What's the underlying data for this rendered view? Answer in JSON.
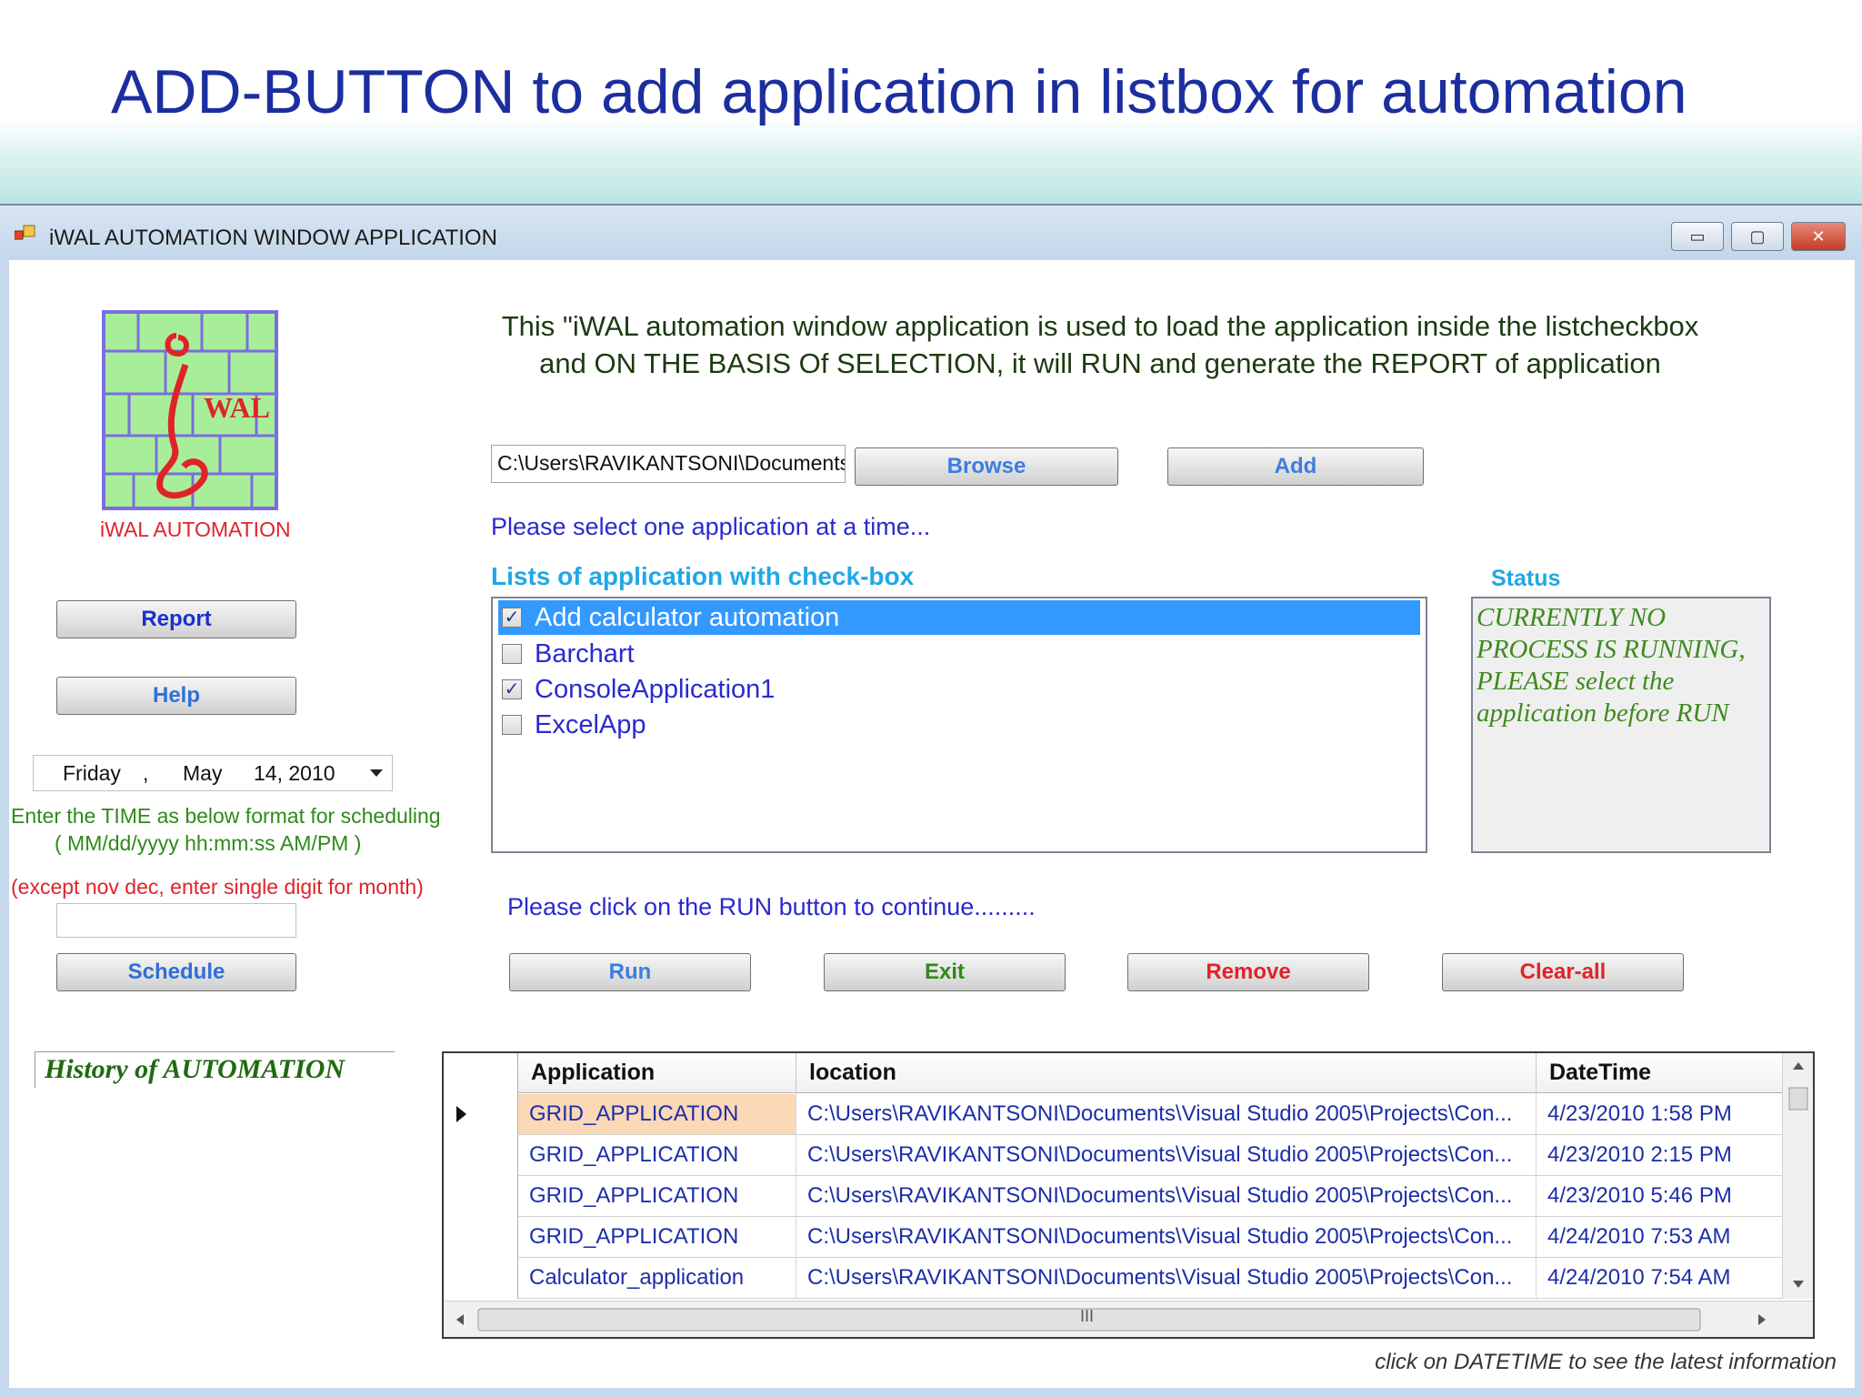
{
  "slide": {
    "title": "ADD-BUTTON  to add application in listbox for automation"
  },
  "window": {
    "title": "iWAL AUTOMATION WINDOW APPLICATION",
    "controls": {
      "minimize": "▭",
      "maximize": "▢",
      "close": "✕"
    }
  },
  "logo": {
    "text": "WAL",
    "caption": "iWAL AUTOMATION"
  },
  "description": {
    "line1": "This \"iWAL automation window application is used to load the application inside the listcheckbox",
    "line2": "and ON THE BASIS Of SELECTION, it will RUN and generate the REPORT of application"
  },
  "path_input": {
    "value": "C:\\Users\\RAVIKANTSONI\\Documents"
  },
  "buttons": {
    "browse": "Browse",
    "add": "Add",
    "report": "Report",
    "help": "Help",
    "schedule": "Schedule",
    "run": "Run",
    "exit": "Exit",
    "remove": "Remove",
    "clear_all": "Clear-all"
  },
  "labels": {
    "select_one": "Please select one application at a time...",
    "list_heading": "Lists of application with check-box",
    "status_heading": "Status",
    "time_format_1": "Enter the TIME as below format for scheduling",
    "time_format_2": "( MM/dd/yyyy hh:mm:ss AM/PM )",
    "month_note": "(except nov  dec, enter single digit for month)",
    "run_prompt": "Please click on the RUN button to continue.........",
    "history": "History of AUTOMATION",
    "footer_note": "click on DATETIME to see the latest information"
  },
  "app_list": [
    {
      "label": "Add  calculator  automation",
      "checked": true,
      "selected": true
    },
    {
      "label": "Barchart",
      "checked": false,
      "selected": false
    },
    {
      "label": "ConsoleApplication1",
      "checked": true,
      "selected": false
    },
    {
      "label": "ExcelApp",
      "checked": false,
      "selected": false
    }
  ],
  "status_text": "CURRENTLY NO PROCESS IS RUNNING, PLEASE select the application before RUN",
  "date_picker": {
    "day": "Friday",
    "sep": ",",
    "month": "May",
    "date": "14, 2010"
  },
  "schedule_input": {
    "value": ""
  },
  "grid": {
    "headers": [
      "Application",
      "location",
      "DateTime"
    ],
    "rows": [
      [
        "GRID_APPLICATION",
        "C:\\Users\\RAVIKANTSONI\\Documents\\Visual Studio 2005\\Projects\\Con...",
        "4/23/2010 1:58 PM"
      ],
      [
        "GRID_APPLICATION",
        "C:\\Users\\RAVIKANTSONI\\Documents\\Visual Studio 2005\\Projects\\Con...",
        "4/23/2010 2:15 PM"
      ],
      [
        "GRID_APPLICATION",
        "C:\\Users\\RAVIKANTSONI\\Documents\\Visual Studio 2005\\Projects\\Con...",
        "4/23/2010 5:46 PM"
      ],
      [
        "GRID_APPLICATION",
        "C:\\Users\\RAVIKANTSONI\\Documents\\Visual Studio 2005\\Projects\\Con...",
        "4/24/2010 7:53 AM"
      ],
      [
        "Calculator_application",
        "C:\\Users\\RAVIKANTSONI\\Documents\\Visual Studio 2005\\Projects\\Con...",
        "4/24/2010 7:54 AM"
      ]
    ],
    "hscroll_grip": "III"
  },
  "colors": {
    "title_blue": "#1c2e9f",
    "link_blue": "#2a2ad0",
    "heading_cyan": "#1fa8e6",
    "green_text": "#3e8a1e",
    "red_text": "#e0232b",
    "selection_blue": "#3399ff",
    "highlight_cell": "#fbd8b6"
  }
}
